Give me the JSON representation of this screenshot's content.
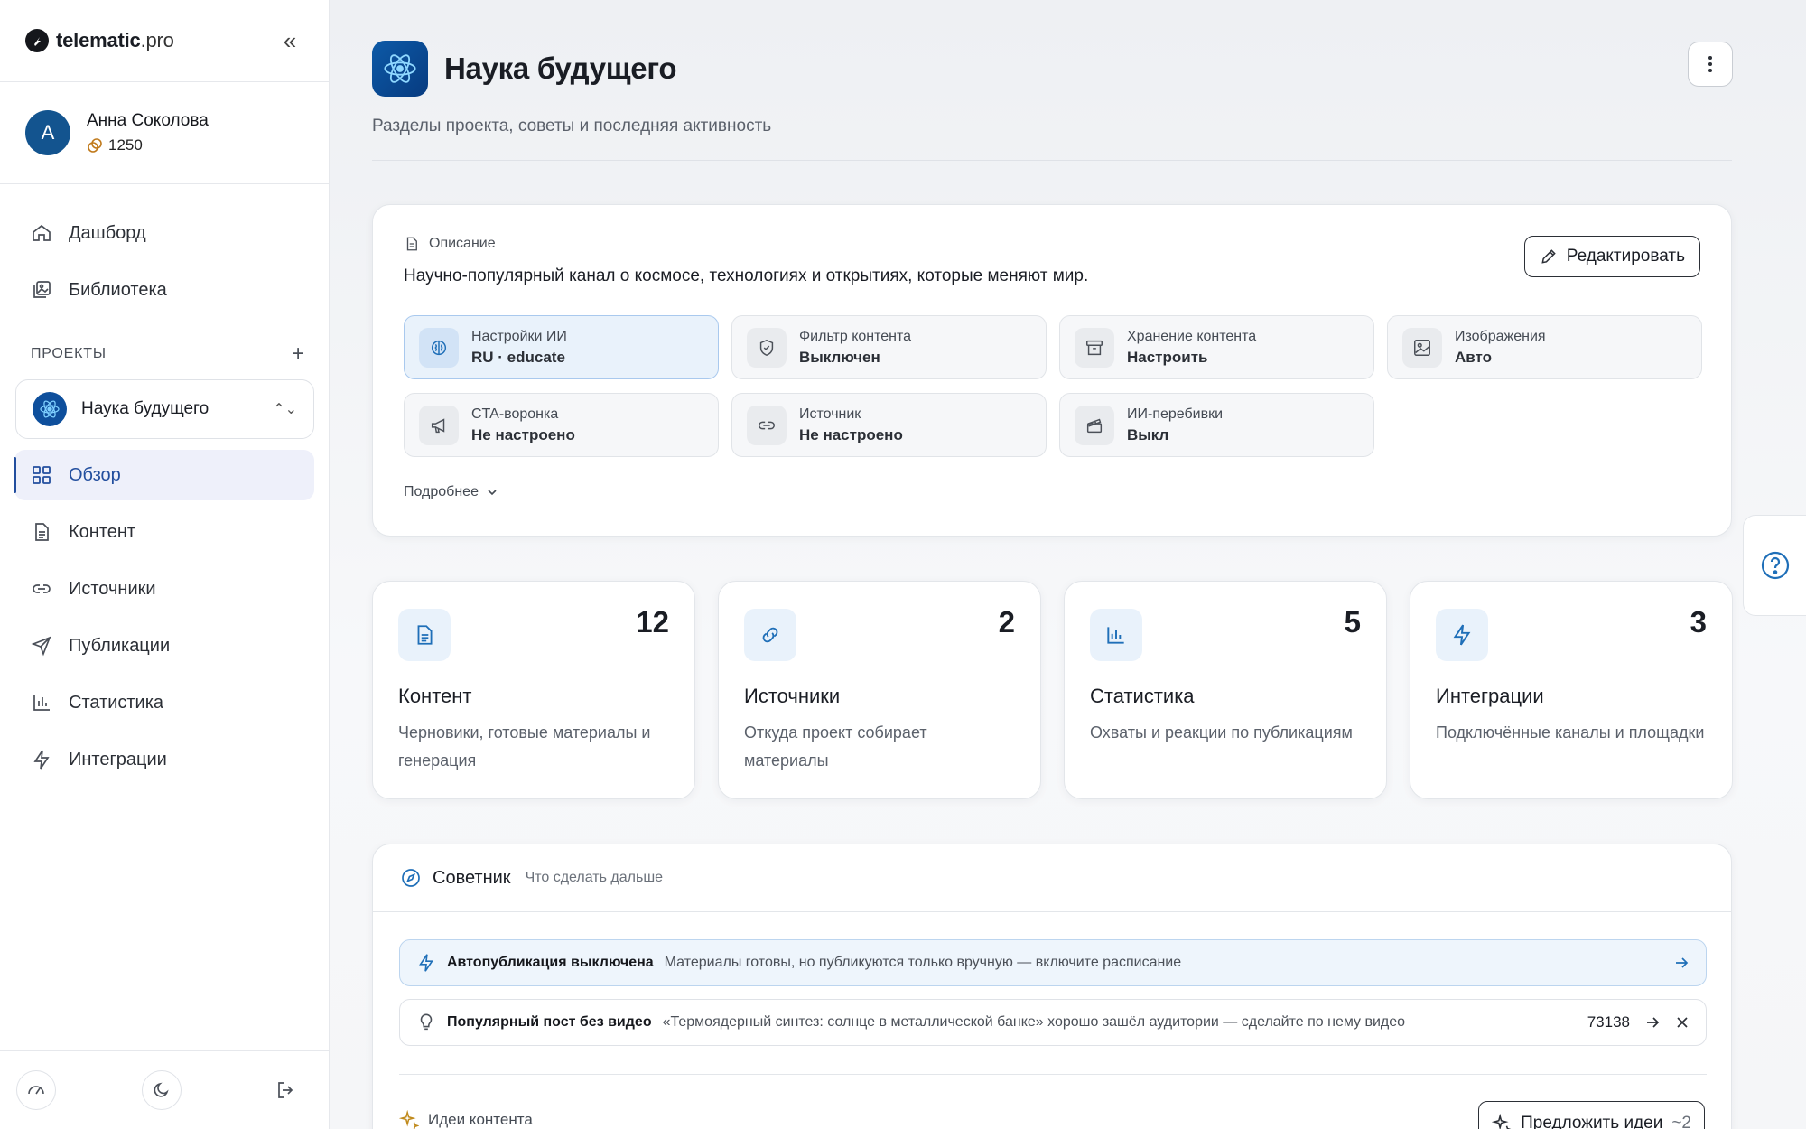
{
  "brand": {
    "name": "telematic",
    "suffix": ".pro"
  },
  "user": {
    "initial": "A",
    "name": "Анна Соколова",
    "credits": "1250"
  },
  "nav_top": [
    {
      "label": "Дашборд",
      "icon": "home-icon"
    },
    {
      "label": "Библиотека",
      "icon": "library-icon"
    }
  ],
  "projects": {
    "heading": "ПРОЕКТЫ",
    "current": "Наука будущего"
  },
  "nav_project": [
    {
      "label": "Обзор",
      "icon": "grid-icon",
      "active": true
    },
    {
      "label": "Контент",
      "icon": "document-icon"
    },
    {
      "label": "Источники",
      "icon": "link-icon"
    },
    {
      "label": "Публикации",
      "icon": "send-icon"
    },
    {
      "label": "Статистика",
      "icon": "bar-chart-icon"
    },
    {
      "label": "Интеграции",
      "icon": "bolt-icon"
    }
  ],
  "page": {
    "title": "Наука будущего",
    "subtitle": "Разделы проекта, советы и последняя активность"
  },
  "description": {
    "label": "Описание",
    "text": "Научно-популярный канал о космосе, технологиях и открытиях, которые меняют мир.",
    "edit_label": "Редактировать",
    "more_label": "Подробнее"
  },
  "settings": [
    {
      "title": "Настройки ИИ",
      "value": "RU · educate",
      "icon": "brain-icon",
      "active": true
    },
    {
      "title": "Фильтр контента",
      "value": "Выключен",
      "icon": "shield-icon"
    },
    {
      "title": "Хранение контента",
      "value": "Настроить",
      "icon": "archive-icon"
    },
    {
      "title": "Изображения",
      "value": "Авто",
      "icon": "image-icon"
    },
    {
      "title": "CTA-воронка",
      "value": "Не настроено",
      "icon": "megaphone-icon"
    },
    {
      "title": "Источник",
      "value": "Не настроено",
      "icon": "link-icon"
    },
    {
      "title": "ИИ-перебивки",
      "value": "Выкл",
      "icon": "clapper-icon"
    }
  ],
  "stats": [
    {
      "count": "12",
      "title": "Контент",
      "desc": "Черновики, готовые материалы и генерация",
      "icon": "document-icon"
    },
    {
      "count": "2",
      "title": "Источники",
      "desc": "Откуда проект собирает материалы",
      "icon": "link-icon"
    },
    {
      "count": "5",
      "title": "Статистика",
      "desc": "Охваты и реакции по публикациям",
      "icon": "bar-chart-icon"
    },
    {
      "count": "3",
      "title": "Интеграции",
      "desc": "Подключённые каналы и площадки",
      "icon": "bolt-icon"
    }
  ],
  "advisor": {
    "title": "Советник",
    "subtitle": "Что сделать дальше",
    "tips": [
      {
        "title": "Автопубликация выключена",
        "message": "Материалы готовы, но публикуются только вручную — включите расписание"
      },
      {
        "title": "Популярный пост без видео",
        "message": "«Термоядерный синтез: солнце в металлической банке» хорошо зашёл аудитории — сделайте по нему видео",
        "number": "73138"
      }
    ],
    "ideas_label": "Идеи контента",
    "suggest_label": "Предложить идеи",
    "suggest_suffix": "~2"
  },
  "colors": {
    "accent": "#224e9e",
    "icon_blue": "#1f6fb8",
    "active_bg": "#eef0fa"
  }
}
